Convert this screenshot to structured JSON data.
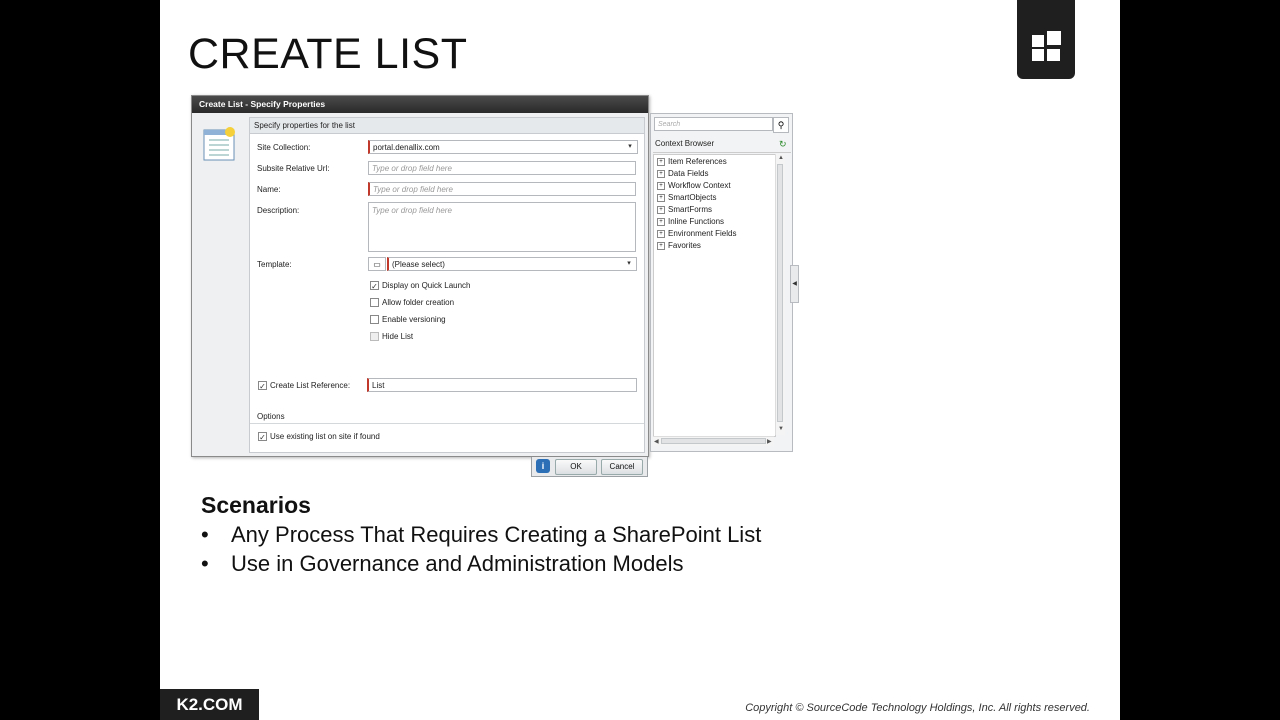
{
  "slide": {
    "title": "CREATE LIST",
    "scenarios_heading": "Scenarios",
    "bullets": [
      "Any Process That Requires Creating a SharePoint List",
      "Use in Governance and Administration Models"
    ],
    "brand": "K2.COM",
    "copyright": "Copyright © SourceCode Technology Holdings, Inc. All rights reserved.",
    "bullet_char": "•"
  },
  "dialog": {
    "title": "Create List - Specify Properties",
    "panel_header": "Specify properties for the list",
    "fields": {
      "site_collection": {
        "label": "Site Collection:",
        "value": "portal.denallix.com"
      },
      "subsite_url": {
        "label": "Subsite Relative Url:",
        "placeholder": "Type or drop field here"
      },
      "name": {
        "label": "Name:",
        "placeholder": "Type or drop field here"
      },
      "description": {
        "label": "Description:",
        "placeholder": "Type or drop field here"
      },
      "template": {
        "label": "Template:",
        "value": "(Please select)"
      }
    },
    "checkboxes": {
      "quick_launch": {
        "label": "Display on Quick Launch",
        "checked": true
      },
      "folder_creation": {
        "label": "Allow folder creation",
        "checked": false
      },
      "versioning": {
        "label": "Enable versioning",
        "checked": false
      },
      "hide_list": {
        "label": "Hide List",
        "checked": false
      }
    },
    "list_reference": {
      "label": "Create List Reference:",
      "value": "List",
      "checked": true
    },
    "options_label": "Options",
    "use_existing": {
      "label": "Use existing list on site if found",
      "checked": true
    },
    "buttons": {
      "ok": "OK",
      "cancel": "Cancel",
      "info": "i"
    }
  },
  "context_browser": {
    "search_placeholder": "Search",
    "title": "Context Browser",
    "items": [
      "Item References",
      "Data Fields",
      "Workflow Context",
      "SmartObjects",
      "SmartForms",
      "Inline Functions",
      "Environment Fields",
      "Favorites"
    ]
  },
  "icons": {
    "check": "✓",
    "dropdown": "▾",
    "plus": "+",
    "search": "⚲",
    "refresh": "↻"
  }
}
